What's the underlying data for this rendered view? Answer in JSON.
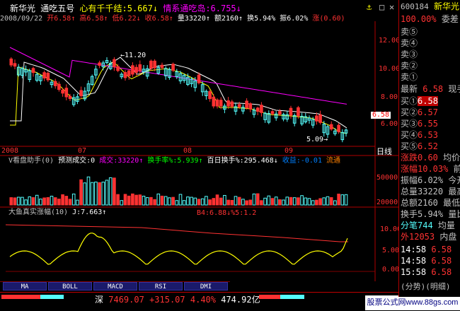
{
  "header": {
    "stock": "新华光",
    "indicator": "通吃五号",
    "line1_a": "心有千千结:5.667↓",
    "line1_b": "情系通吃岛:6.755↓",
    "date": "2008/09/22",
    "open": "开6.58↑",
    "high": "高6.58↑",
    "low": "低6.22↓",
    "close": "收6.58↑",
    "volume": "量33220↑",
    "amount": "额2160↑",
    "turnover": "换5.94%",
    "amplitude": "振6.02%",
    "change": "涨(0.60)"
  },
  "main_chart": {
    "y_ticks": [
      "12.00",
      "10.00",
      "8.00",
      "6.00"
    ],
    "x_labels": [
      "2008",
      "07",
      "08",
      "09"
    ],
    "max_label": "11.20",
    "min_label": "5.09",
    "price_tag": "6.58",
    "day_label": "日线"
  },
  "volume_panel": {
    "label": "V看盘助手(0)",
    "label2": "预测成交:0",
    "deal": "成交:33220↑",
    "turnover_rate": "换手率%:5.939↑",
    "hundred_day": "百日换手%:295.468↓",
    "profit": "收益:-0.01",
    "flow": "流通",
    "y_ticks": [
      "50000",
      "20000"
    ]
  },
  "indicator_panel": {
    "label": "大鱼真实涨幅(10)",
    "j_value": "J:7.663↑",
    "red_label": "B4:6.88↓%5:1.2",
    "y_ticks": [
      "10.00",
      "5.00",
      "0.00"
    ]
  },
  "tabs": [
    "MA",
    "BOLL",
    "MACD",
    "RSI",
    "DMI"
  ],
  "status_bar": {
    "market": "深",
    "index": "7469.07",
    "change": "+315.07",
    "percent": "4.40%",
    "amount": "474.92亿"
  },
  "logo_text": "股票公式网www.88gs.com",
  "side_panel": {
    "code": "600184",
    "name": "新华光",
    "commission": "100.00%",
    "commission_label": "委差",
    "ask_rows": [
      "卖⑤",
      "卖④",
      "卖③",
      "卖②",
      "卖①"
    ],
    "last_label": "最新",
    "last_value": "6.58",
    "spot_label": "现手",
    "bid_rows": [
      {
        "label": "买①",
        "value": "6.58"
      },
      {
        "label": "买②",
        "value": "6.57"
      },
      {
        "label": "买③",
        "value": "6.55"
      },
      {
        "label": "买④",
        "value": "6.53"
      },
      {
        "label": "买⑤",
        "value": "6.52"
      }
    ],
    "stats": [
      {
        "label": "涨跌0.60",
        "extra": "均价"
      },
      {
        "label": "涨幅10.03%",
        "extra": "前收"
      },
      {
        "label": "振幅6.02%",
        "extra": "今开"
      },
      {
        "label": "总量33220",
        "extra": "最高"
      },
      {
        "label": "总额2160",
        "extra": "最低"
      },
      {
        "label": "换手5.94%",
        "extra": "量比"
      },
      {
        "label": "分笔744",
        "extra": "均量"
      },
      {
        "label": "外12053",
        "extra": "内盘"
      }
    ],
    "ticks": [
      {
        "time": "14:58",
        "price": "6.58"
      },
      {
        "time": "14:58",
        "price": "6.58"
      },
      {
        "time": "15:58",
        "price": "6.58"
      }
    ],
    "bottom_label": "(分势)(明细)"
  },
  "colors": {
    "up": "#ff3232",
    "down": "#54fcfc",
    "ma_white": "#ffffff",
    "ma_yellow": "#ffff00",
    "ma_magenta": "#ff00ff",
    "grid_red": "#b00000"
  },
  "icons": [
    "arrow-up-icon",
    "arrow-down-icon",
    "anchor-icon",
    "square-icon",
    "close-icon"
  ]
}
